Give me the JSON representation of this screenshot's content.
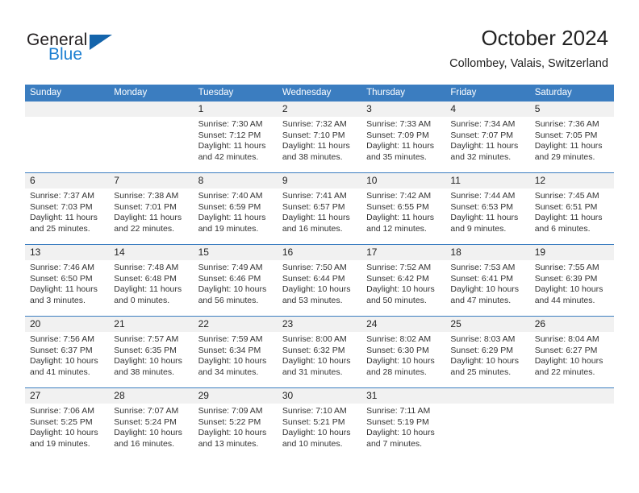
{
  "brand": {
    "name_top": "General",
    "name_bottom": "Blue",
    "triangle_color": "#1464ab",
    "blue_color": "#1c7fd1",
    "dark_color": "#231f20"
  },
  "header": {
    "title": "October 2024",
    "subtitle": "Collombey, Valais, Switzerland"
  },
  "theme": {
    "header_bar": "#3b7dc0",
    "daynum_band": "#f1f1f1",
    "row_divider": "#3b7dc0",
    "text": "#333333"
  },
  "weekdays": [
    "Sunday",
    "Monday",
    "Tuesday",
    "Wednesday",
    "Thursday",
    "Friday",
    "Saturday"
  ],
  "weeks": [
    [
      {
        "day": "",
        "lines": []
      },
      {
        "day": "",
        "lines": []
      },
      {
        "day": "1",
        "lines": [
          "Sunrise: 7:30 AM",
          "Sunset: 7:12 PM",
          "Daylight: 11 hours",
          "and 42 minutes."
        ]
      },
      {
        "day": "2",
        "lines": [
          "Sunrise: 7:32 AM",
          "Sunset: 7:10 PM",
          "Daylight: 11 hours",
          "and 38 minutes."
        ]
      },
      {
        "day": "3",
        "lines": [
          "Sunrise: 7:33 AM",
          "Sunset: 7:09 PM",
          "Daylight: 11 hours",
          "and 35 minutes."
        ]
      },
      {
        "day": "4",
        "lines": [
          "Sunrise: 7:34 AM",
          "Sunset: 7:07 PM",
          "Daylight: 11 hours",
          "and 32 minutes."
        ]
      },
      {
        "day": "5",
        "lines": [
          "Sunrise: 7:36 AM",
          "Sunset: 7:05 PM",
          "Daylight: 11 hours",
          "and 29 minutes."
        ]
      }
    ],
    [
      {
        "day": "6",
        "lines": [
          "Sunrise: 7:37 AM",
          "Sunset: 7:03 PM",
          "Daylight: 11 hours",
          "and 25 minutes."
        ]
      },
      {
        "day": "7",
        "lines": [
          "Sunrise: 7:38 AM",
          "Sunset: 7:01 PM",
          "Daylight: 11 hours",
          "and 22 minutes."
        ]
      },
      {
        "day": "8",
        "lines": [
          "Sunrise: 7:40 AM",
          "Sunset: 6:59 PM",
          "Daylight: 11 hours",
          "and 19 minutes."
        ]
      },
      {
        "day": "9",
        "lines": [
          "Sunrise: 7:41 AM",
          "Sunset: 6:57 PM",
          "Daylight: 11 hours",
          "and 16 minutes."
        ]
      },
      {
        "day": "10",
        "lines": [
          "Sunrise: 7:42 AM",
          "Sunset: 6:55 PM",
          "Daylight: 11 hours",
          "and 12 minutes."
        ]
      },
      {
        "day": "11",
        "lines": [
          "Sunrise: 7:44 AM",
          "Sunset: 6:53 PM",
          "Daylight: 11 hours",
          "and 9 minutes."
        ]
      },
      {
        "day": "12",
        "lines": [
          "Sunrise: 7:45 AM",
          "Sunset: 6:51 PM",
          "Daylight: 11 hours",
          "and 6 minutes."
        ]
      }
    ],
    [
      {
        "day": "13",
        "lines": [
          "Sunrise: 7:46 AM",
          "Sunset: 6:50 PM",
          "Daylight: 11 hours",
          "and 3 minutes."
        ]
      },
      {
        "day": "14",
        "lines": [
          "Sunrise: 7:48 AM",
          "Sunset: 6:48 PM",
          "Daylight: 11 hours",
          "and 0 minutes."
        ]
      },
      {
        "day": "15",
        "lines": [
          "Sunrise: 7:49 AM",
          "Sunset: 6:46 PM",
          "Daylight: 10 hours",
          "and 56 minutes."
        ]
      },
      {
        "day": "16",
        "lines": [
          "Sunrise: 7:50 AM",
          "Sunset: 6:44 PM",
          "Daylight: 10 hours",
          "and 53 minutes."
        ]
      },
      {
        "day": "17",
        "lines": [
          "Sunrise: 7:52 AM",
          "Sunset: 6:42 PM",
          "Daylight: 10 hours",
          "and 50 minutes."
        ]
      },
      {
        "day": "18",
        "lines": [
          "Sunrise: 7:53 AM",
          "Sunset: 6:41 PM",
          "Daylight: 10 hours",
          "and 47 minutes."
        ]
      },
      {
        "day": "19",
        "lines": [
          "Sunrise: 7:55 AM",
          "Sunset: 6:39 PM",
          "Daylight: 10 hours",
          "and 44 minutes."
        ]
      }
    ],
    [
      {
        "day": "20",
        "lines": [
          "Sunrise: 7:56 AM",
          "Sunset: 6:37 PM",
          "Daylight: 10 hours",
          "and 41 minutes."
        ]
      },
      {
        "day": "21",
        "lines": [
          "Sunrise: 7:57 AM",
          "Sunset: 6:35 PM",
          "Daylight: 10 hours",
          "and 38 minutes."
        ]
      },
      {
        "day": "22",
        "lines": [
          "Sunrise: 7:59 AM",
          "Sunset: 6:34 PM",
          "Daylight: 10 hours",
          "and 34 minutes."
        ]
      },
      {
        "day": "23",
        "lines": [
          "Sunrise: 8:00 AM",
          "Sunset: 6:32 PM",
          "Daylight: 10 hours",
          "and 31 minutes."
        ]
      },
      {
        "day": "24",
        "lines": [
          "Sunrise: 8:02 AM",
          "Sunset: 6:30 PM",
          "Daylight: 10 hours",
          "and 28 minutes."
        ]
      },
      {
        "day": "25",
        "lines": [
          "Sunrise: 8:03 AM",
          "Sunset: 6:29 PM",
          "Daylight: 10 hours",
          "and 25 minutes."
        ]
      },
      {
        "day": "26",
        "lines": [
          "Sunrise: 8:04 AM",
          "Sunset: 6:27 PM",
          "Daylight: 10 hours",
          "and 22 minutes."
        ]
      }
    ],
    [
      {
        "day": "27",
        "lines": [
          "Sunrise: 7:06 AM",
          "Sunset: 5:25 PM",
          "Daylight: 10 hours",
          "and 19 minutes."
        ]
      },
      {
        "day": "28",
        "lines": [
          "Sunrise: 7:07 AM",
          "Sunset: 5:24 PM",
          "Daylight: 10 hours",
          "and 16 minutes."
        ]
      },
      {
        "day": "29",
        "lines": [
          "Sunrise: 7:09 AM",
          "Sunset: 5:22 PM",
          "Daylight: 10 hours",
          "and 13 minutes."
        ]
      },
      {
        "day": "30",
        "lines": [
          "Sunrise: 7:10 AM",
          "Sunset: 5:21 PM",
          "Daylight: 10 hours",
          "and 10 minutes."
        ]
      },
      {
        "day": "31",
        "lines": [
          "Sunrise: 7:11 AM",
          "Sunset: 5:19 PM",
          "Daylight: 10 hours",
          "and 7 minutes."
        ]
      },
      {
        "day": "",
        "lines": []
      },
      {
        "day": "",
        "lines": []
      }
    ]
  ]
}
